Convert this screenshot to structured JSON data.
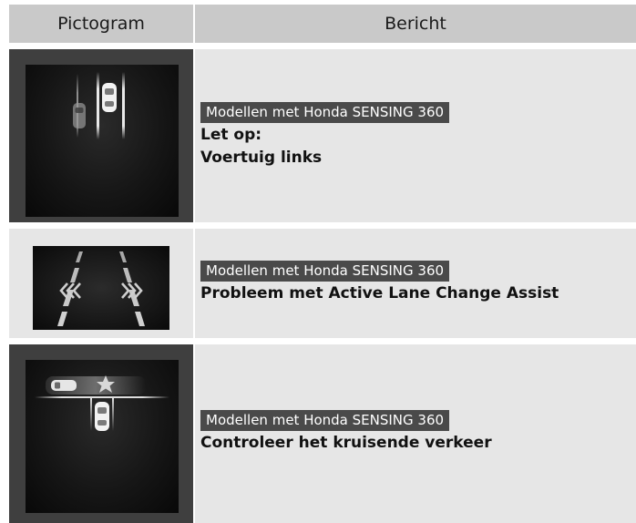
{
  "header": {
    "col1": "Pictogram",
    "col2": "Bericht"
  },
  "rows": [
    {
      "icon": "vehicle-left-warning-icon",
      "tag": "Modellen met Honda SENSING 360",
      "lines": [
        "Let op:",
        "Voertuig links"
      ]
    },
    {
      "icon": "active-lane-change-assist-problem-icon",
      "tag": "Modellen met Honda SENSING 360",
      "lines": [
        "Probleem met Active Lane Change Assist"
      ]
    },
    {
      "icon": "cross-traffic-check-icon",
      "tag": "Modellen met Honda SENSING 360",
      "lines": [
        "Controleer het kruisende verkeer"
      ]
    }
  ],
  "colors": {
    "header_bg": "#c9c9c9",
    "cell_bg": "#e6e6e6",
    "icon_frame": "#3f3f3f",
    "tag_bg": "#4a4a4a"
  }
}
